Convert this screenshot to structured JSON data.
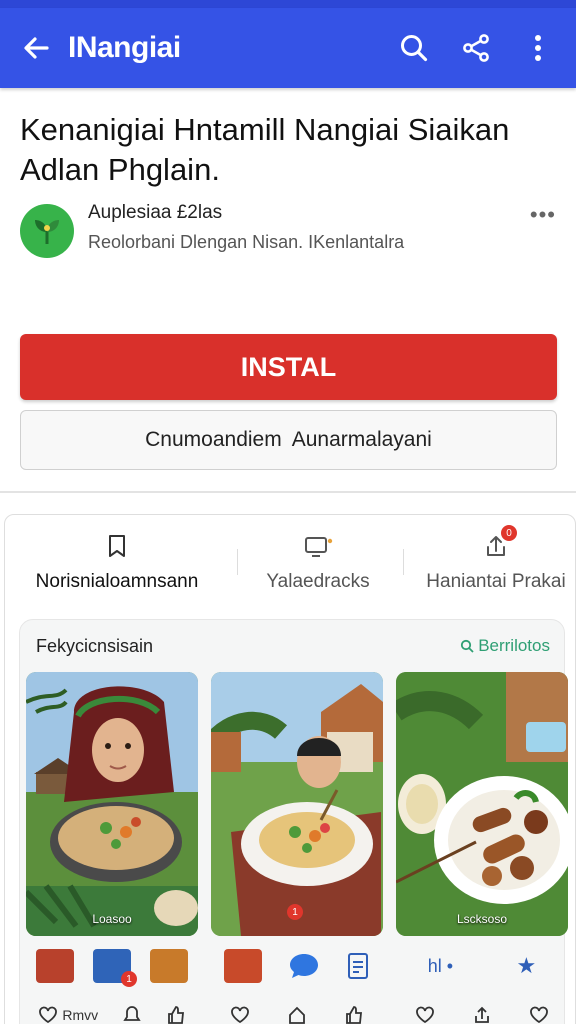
{
  "appbar": {
    "title": "INangiai",
    "back_icon": "arrow-left-icon",
    "search_icon": "search-icon",
    "share_icon": "share-icon",
    "more_icon": "more-vertical-icon",
    "color": "#3553e6"
  },
  "app": {
    "title": "Kenanigiai Hntamill Nangiai Siaikan Adlan Phglain.",
    "developer": "Auplesiaa £2las",
    "subtitle": "Reolorbani Dlengan Nisan. IKenlantalra",
    "logo_icon": "leaf-logo-icon",
    "more_label": "•••"
  },
  "buttons": {
    "install": "INSTAL",
    "install_color": "#d9302b",
    "secondary": "Cnumoandiem  Aunarmalayani"
  },
  "tabs": [
    {
      "label": "Norisnialoamnsann",
      "icon": "bookmark-icon"
    },
    {
      "label": "Yalaedracks",
      "icon": "monitor-icon"
    },
    {
      "label": "Haniantai Prakai",
      "icon": "upload-icon",
      "badge": "0"
    }
  ],
  "gallery": {
    "title": "Fekycicnsisain",
    "link": "Berrilotos",
    "link_icon": "search-icon",
    "shots": [
      {
        "caption": "Loasoo",
        "thumb_badge": "1"
      },
      {
        "caption": "",
        "badge": "1"
      },
      {
        "caption": "Lscksoso"
      }
    ],
    "actions": [
      [
        "Rmvv",
        "",
        ""
      ],
      [
        "",
        "",
        ""
      ],
      [
        "",
        "",
        ""
      ]
    ],
    "extra_labels": [
      "hl •",
      "★"
    ]
  }
}
